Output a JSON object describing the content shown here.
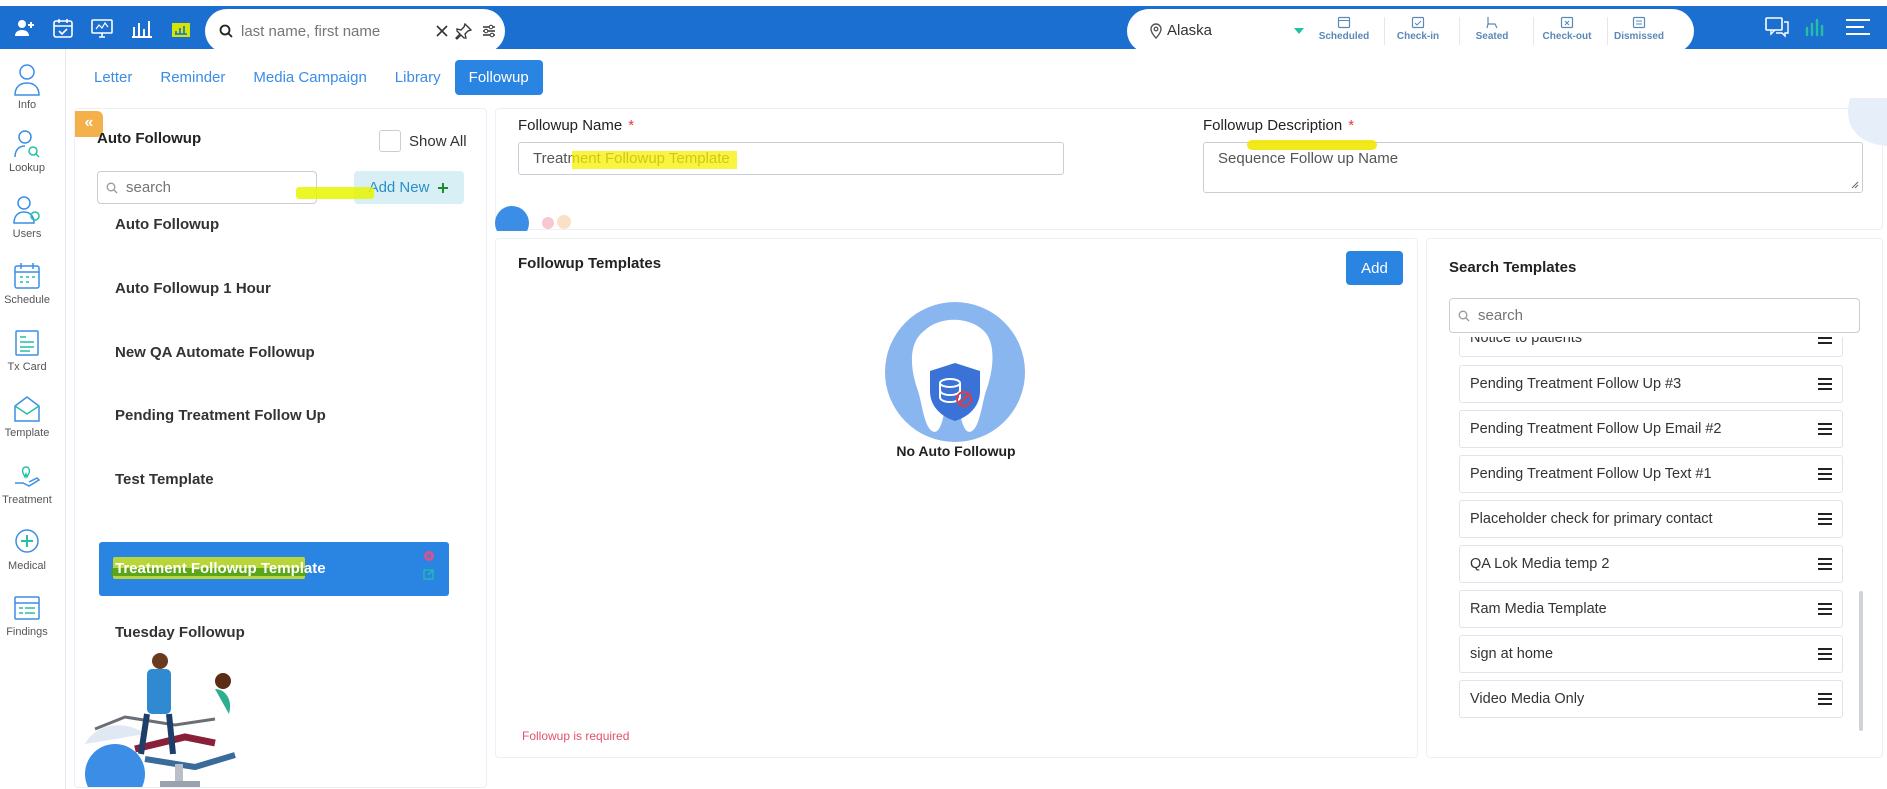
{
  "topbar": {
    "search_placeholder": "last name, first name",
    "location": "Alaska",
    "statuses": [
      "Scheduled",
      "Check-in",
      "Seated",
      "Check-out",
      "Dismissed"
    ]
  },
  "sidebar": {
    "items": [
      {
        "label": "Info",
        "icon": "info-person-icon"
      },
      {
        "label": "Lookup",
        "icon": "lookup-icon"
      },
      {
        "label": "Users",
        "icon": "users-icon"
      },
      {
        "label": "Schedule",
        "icon": "schedule-icon"
      },
      {
        "label": "Tx Card",
        "icon": "tx-card-icon"
      },
      {
        "label": "Template",
        "icon": "template-icon"
      },
      {
        "label": "Treatment",
        "icon": "treatment-icon"
      },
      {
        "label": "Medical",
        "icon": "medical-icon"
      },
      {
        "label": "Findings",
        "icon": "findings-icon"
      }
    ]
  },
  "tabs": [
    "Letter",
    "Reminder",
    "Media Campaign",
    "Library",
    "Followup"
  ],
  "active_tab": "Followup",
  "left_panel": {
    "title": "Auto Followup",
    "show_all_label": "Show All",
    "search_placeholder": "search",
    "add_new_label": "Add New",
    "items": [
      "Auto Followup",
      "Auto Followup 1 Hour",
      "New QA Automate Followup",
      "Pending Treatment Follow Up",
      "Test Template",
      "Treatment Followup Template",
      "Tuesday Followup"
    ],
    "selected_item": "Treatment Followup Template"
  },
  "form": {
    "name_label": "Followup Name",
    "name_value": "Treatment Followup Template",
    "desc_label": "Followup Description",
    "desc_value": "Sequence Follow up Name",
    "required_mark": "*"
  },
  "templates_panel": {
    "title": "Followup Templates",
    "add_label": "Add",
    "empty_text": "No Auto Followup",
    "error_text": "Followup is required"
  },
  "search_panel": {
    "title": "Search Templates",
    "search_placeholder": "search",
    "items": [
      "Notice to patients",
      "Pending Treatment Follow Up #3",
      "Pending Treatment Follow Up Email #2",
      "Pending Treatment Follow Up Text #1",
      "Placeholder check for primary contact",
      "QA Lok Media temp 2",
      "Ram Media Template",
      "sign at home",
      "Video Media Only"
    ]
  },
  "colors": {
    "primary": "#2a84e2",
    "topbar": "#1a6fd0",
    "accent_teal": "#24c0a6",
    "required": "#e23c3c",
    "error": "#e2526a"
  }
}
